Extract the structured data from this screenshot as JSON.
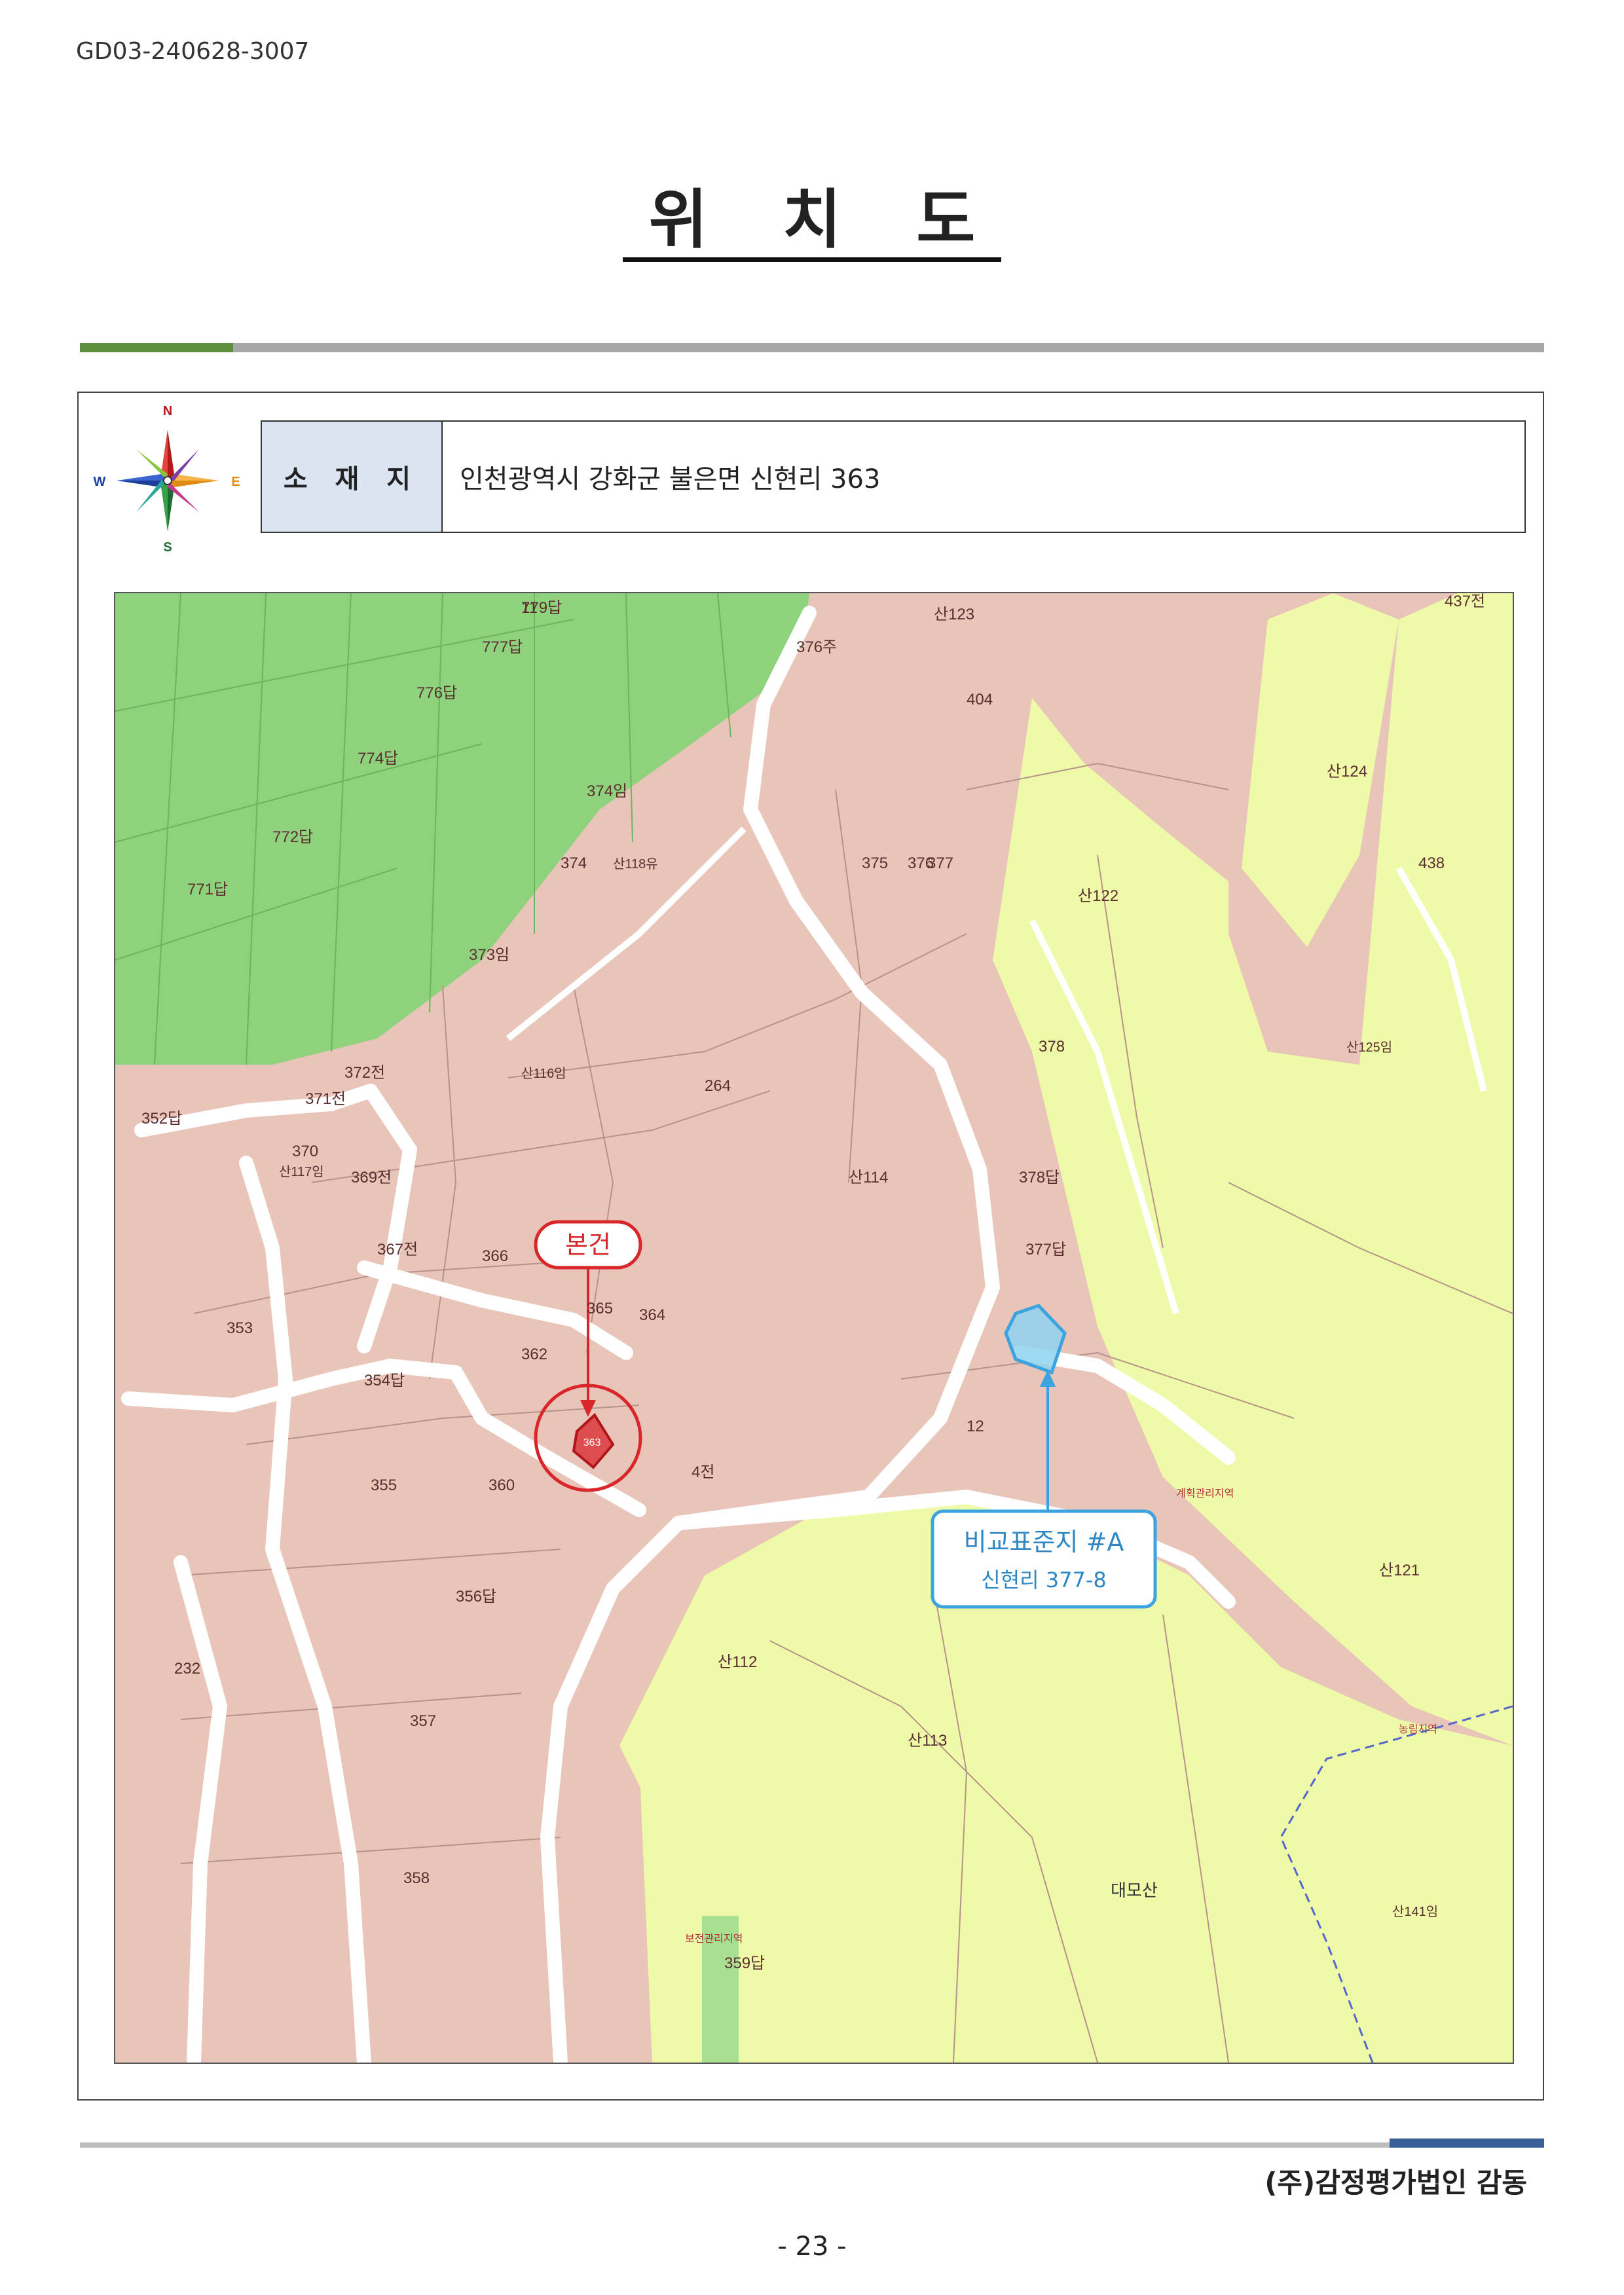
{
  "doc_id": "GD03-240628-3007",
  "title": "위 치 도",
  "compass": {
    "n": "N",
    "s": "S",
    "e": "E",
    "w": "W"
  },
  "location": {
    "label": "소 재 지",
    "value": "인천광역시 강화군 불은면 신현리 363"
  },
  "map": {
    "subject_label": "본건",
    "subject_parcel": "363",
    "comparison_title": "비교표준지 #A",
    "comparison_address": "신현리 377-8",
    "mountain_name": "대모산",
    "parcel_labels": [
      "779답",
      "777답",
      "776답",
      "774답",
      "772답",
      "771답",
      "374임",
      "373임",
      "372전",
      "371전",
      "352답",
      "370",
      "369전",
      "367전",
      "366",
      "365",
      "364",
      "362",
      "353",
      "354답",
      "355",
      "360",
      "356답",
      "357",
      "358",
      "359답",
      "232",
      "404",
      "378",
      "377",
      "376",
      "375",
      "374",
      "264",
      "산116임",
      "산114",
      "산112",
      "산113",
      "산121",
      "산122",
      "산124",
      "산125임",
      "산141임",
      "산117임",
      "산123",
      "산118유",
      "378답",
      "377답",
      "376주",
      "437전",
      "438",
      "4전",
      "12",
      "11"
    ],
    "zone_labels": [
      "계획관리지역",
      "농림지역",
      "보전관리지역"
    ],
    "colors": {
      "building_zone": "#e8c4b9",
      "farmland": "#8fd27e",
      "forest": "#eefaa8",
      "road": "#ffffff",
      "subject": "#d9262b",
      "comparison": "#3aa3e0"
    }
  },
  "footer": {
    "company": "(주)감정평가법인 감동",
    "page": "- 23 -"
  }
}
